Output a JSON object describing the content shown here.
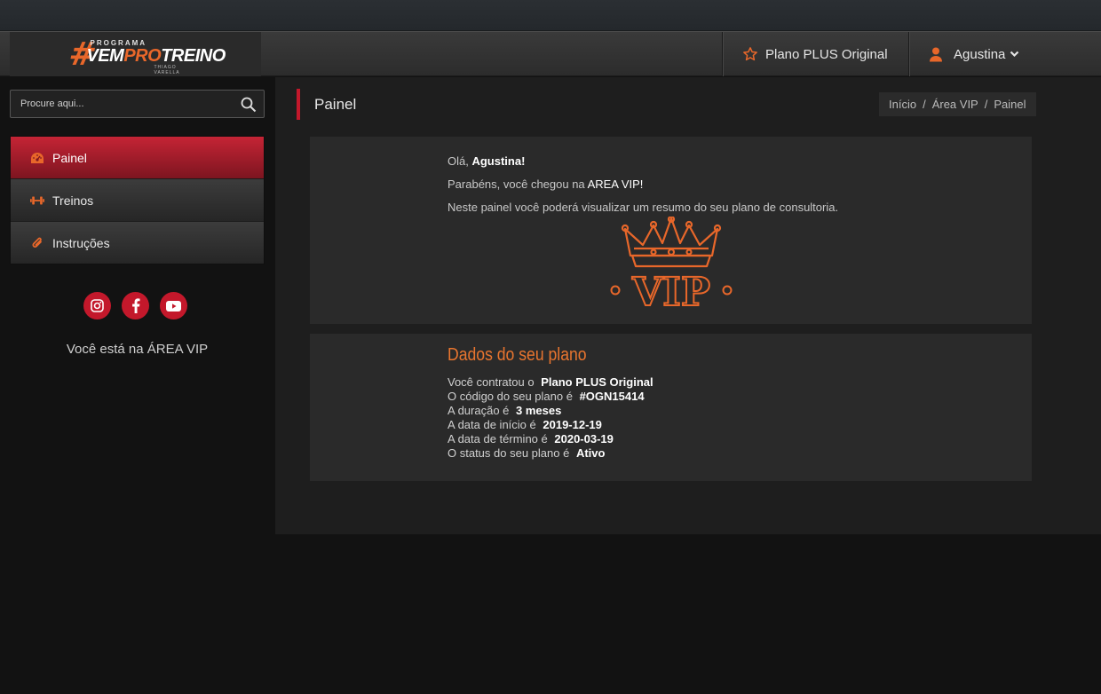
{
  "brand": {
    "programa": "PROGRAMA",
    "vem": "VEM",
    "pro": "PRO",
    "treino": "TREINO",
    "signature": "THIAGO VARELLA",
    "hash": "#"
  },
  "navbar": {
    "plan_label": "Plano PLUS Original",
    "user_name": "Agustina"
  },
  "search": {
    "placeholder": "Procure aqui..."
  },
  "sidebar": {
    "items": [
      {
        "label": "Painel",
        "icon": "dashboard-icon",
        "active": true
      },
      {
        "label": "Treinos",
        "icon": "dumbbell-icon",
        "active": false
      },
      {
        "label": "Instruções",
        "icon": "paperclip-icon",
        "active": false
      }
    ],
    "social": [
      "instagram-icon",
      "facebook-icon",
      "youtube-icon"
    ],
    "vip_note": "Você está na ÁREA VIP"
  },
  "page": {
    "title": "Painel",
    "breadcrumb": [
      "Início",
      "Área VIP",
      "Painel"
    ],
    "breadcrumb_sep": "/"
  },
  "welcome": {
    "greeting": "Olá,",
    "name": "Agustina!",
    "line2_prefix": "Parabéns, você chegou na ",
    "line2_strong": "AREA VIP!",
    "line3": "Neste painel você poderá visualizar um resumo do seu plano de consultoria.",
    "vip_text": "VIP"
  },
  "plan": {
    "heading": "Dados do seu plano",
    "rows": [
      {
        "label": "Você contratou o",
        "value": "Plano PLUS Original"
      },
      {
        "label": "O código do seu plano é",
        "value": "#OGN15414"
      },
      {
        "label": "A duração é",
        "value": "3 meses"
      },
      {
        "label": "A data de início é",
        "value": "2019-12-19"
      },
      {
        "label": "A data de término é",
        "value": "2020-03-19"
      },
      {
        "label": "O status do seu plano é",
        "value": "Ativo"
      }
    ]
  },
  "colors": {
    "accent_red": "#c3182b",
    "accent_orange": "#e8672a",
    "background": "#121212",
    "panel": "#2a2a2a"
  }
}
